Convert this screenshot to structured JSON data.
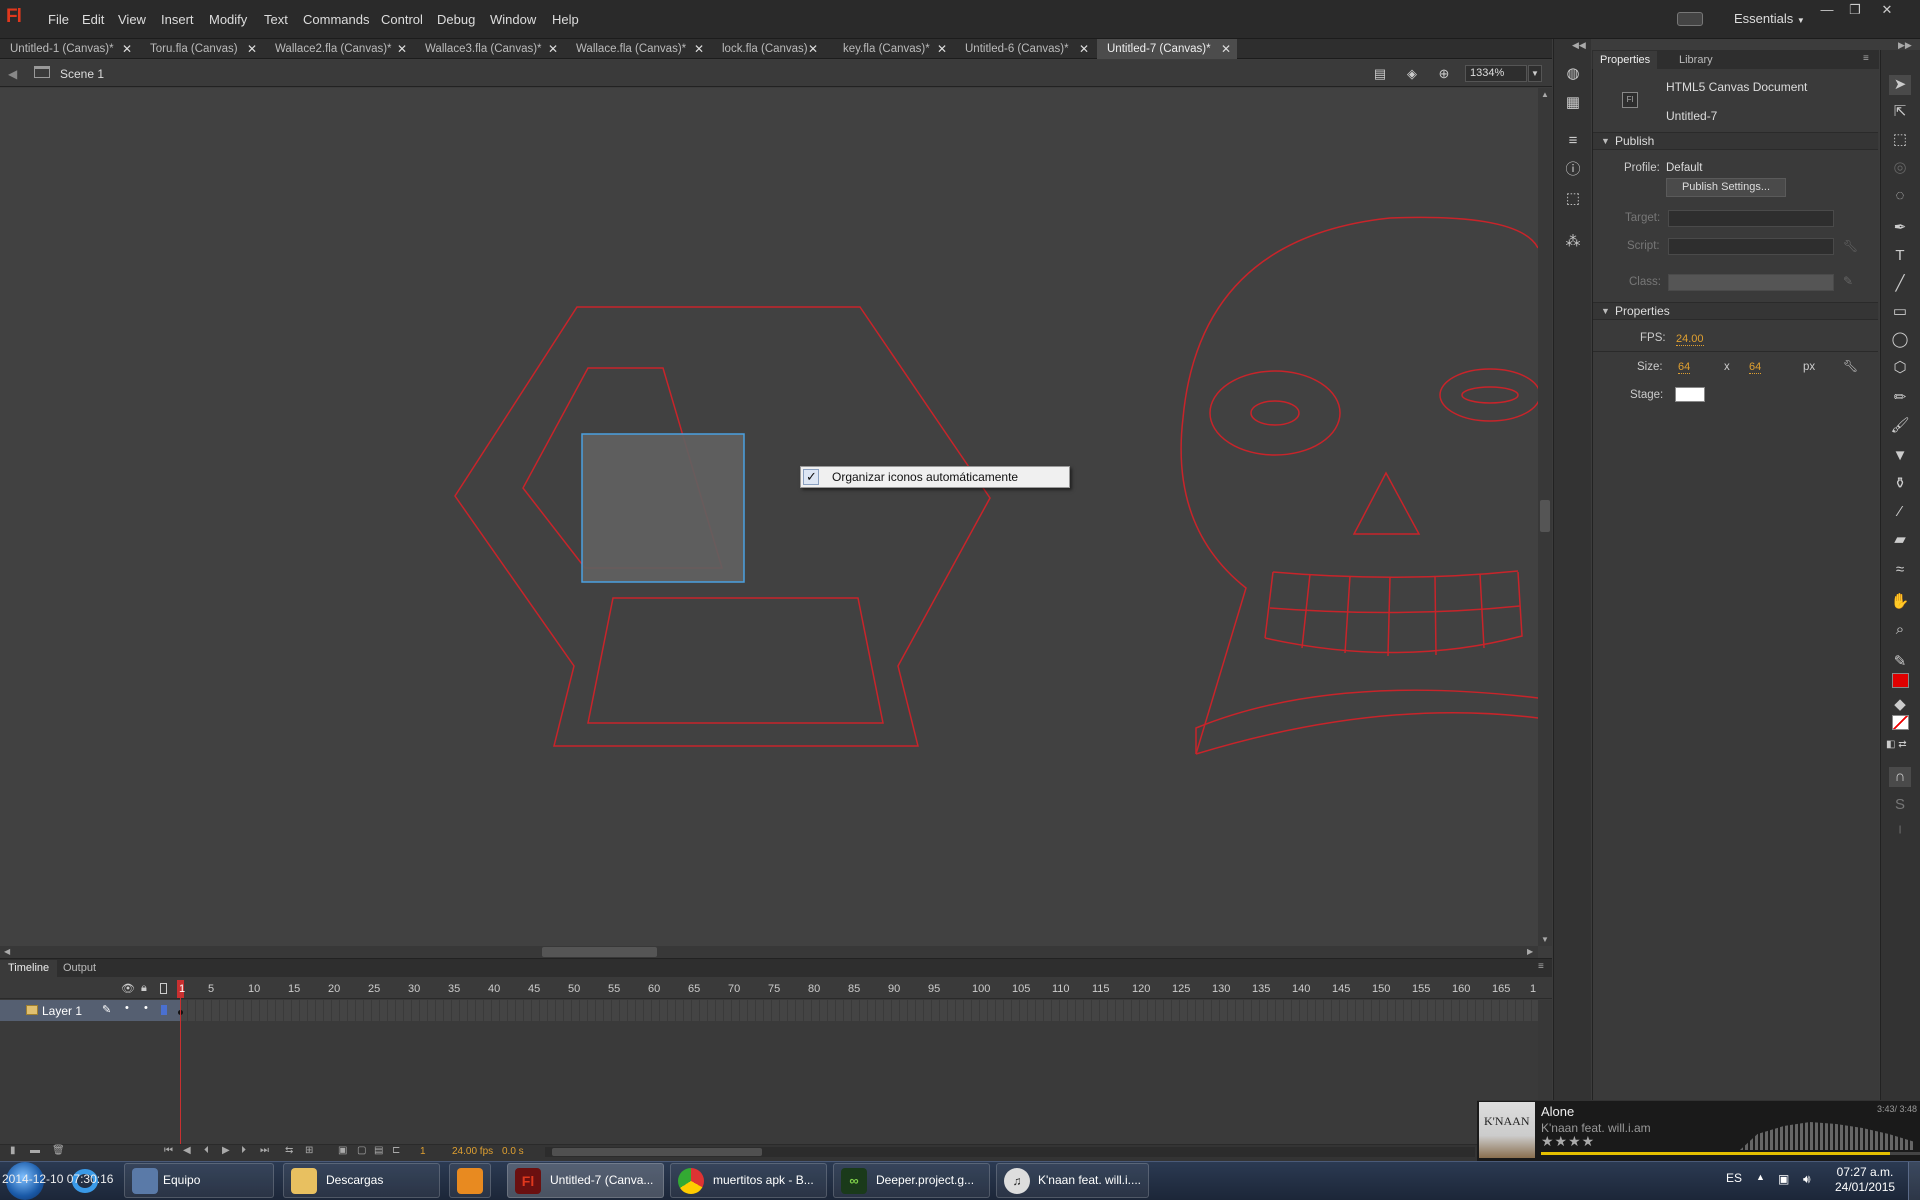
{
  "menubar": {
    "logo": "Fl",
    "items": [
      "File",
      "Edit",
      "View",
      "Insert",
      "Modify",
      "Text",
      "Commands",
      "Control",
      "Debug",
      "Window",
      "Help"
    ],
    "workspace": "Essentials",
    "window_buttons": [
      "—",
      "❐",
      "✕"
    ]
  },
  "doc_tabs": [
    {
      "label": "Untitled-1 (Canvas)*"
    },
    {
      "label": "Toru.fla (Canvas)"
    },
    {
      "label": "Wallace2.fla (Canvas)*"
    },
    {
      "label": "Wallace3.fla (Canvas)*"
    },
    {
      "label": "Wallace.fla (Canvas)*"
    },
    {
      "label": "lock.fla (Canvas)"
    },
    {
      "label": "key.fla (Canvas)*"
    },
    {
      "label": "Untitled-6 (Canvas)*"
    },
    {
      "label": "Untitled-7 (Canvas)*",
      "active": true
    }
  ],
  "editbar": {
    "scene": "Scene 1",
    "zoom": "1334%"
  },
  "context_menu": {
    "check": "✓",
    "label": "Organizar iconos automáticamente"
  },
  "properties_panel": {
    "tabs": [
      "Properties",
      "Library"
    ],
    "doc_type": "HTML5 Canvas Document",
    "doc_name": "Untitled-7",
    "publish_section": "Publish",
    "profile_label": "Profile:",
    "profile_value": "Default",
    "publish_settings_button": "Publish Settings...",
    "target_label": "Target:",
    "script_label": "Script:",
    "class_label": "Class:",
    "properties_section": "Properties",
    "fps_label": "FPS:",
    "fps_value": "24.00",
    "size_label": "Size:",
    "width": "64",
    "x": "x",
    "height": "64",
    "unit": "px",
    "stage_label": "Stage:",
    "stage_color": "#ffffff"
  },
  "timeline": {
    "tabs": [
      "Timeline",
      "Output"
    ],
    "layer_name": "Layer 1",
    "frame_numbers": [
      "1",
      "5",
      "10",
      "15",
      "20",
      "25",
      "30",
      "35",
      "40",
      "45",
      "50",
      "55",
      "60",
      "65",
      "70",
      "75",
      "80",
      "85",
      "90",
      "95",
      "100",
      "105",
      "110",
      "115",
      "120",
      "125",
      "130",
      "135",
      "140",
      "145",
      "150",
      "155",
      "160",
      "165",
      "1"
    ],
    "current_frame": "1",
    "fps": "24.00 fps",
    "elapsed": "0.0 s"
  },
  "music_player": {
    "album": "K'NAAN",
    "song": "Alone",
    "artist": "K'naan feat. will.i.am",
    "time": "3:43/ 3:48",
    "stars": "★★★★",
    "progress": 0.92
  },
  "taskbar": {
    "overlay_date": "2014-12-10 07:30:16",
    "buttons": [
      {
        "label": "Equipo"
      },
      {
        "label": "Descargas"
      },
      {
        "label": ""
      },
      {
        "label": "Untitled-7 (Canva..."
      },
      {
        "label": "muertitos apk - B..."
      },
      {
        "label": "Deeper.project.g..."
      },
      {
        "label": "K'naan feat. will.i...."
      }
    ],
    "lang": "ES",
    "time": "07:27 a.m.",
    "date": "24/01/2015"
  },
  "colors": {
    "stroke": "#c8242a",
    "accent": "#e0381d",
    "selection": "#4aa0e0",
    "fill_swatch": "#e00000"
  }
}
